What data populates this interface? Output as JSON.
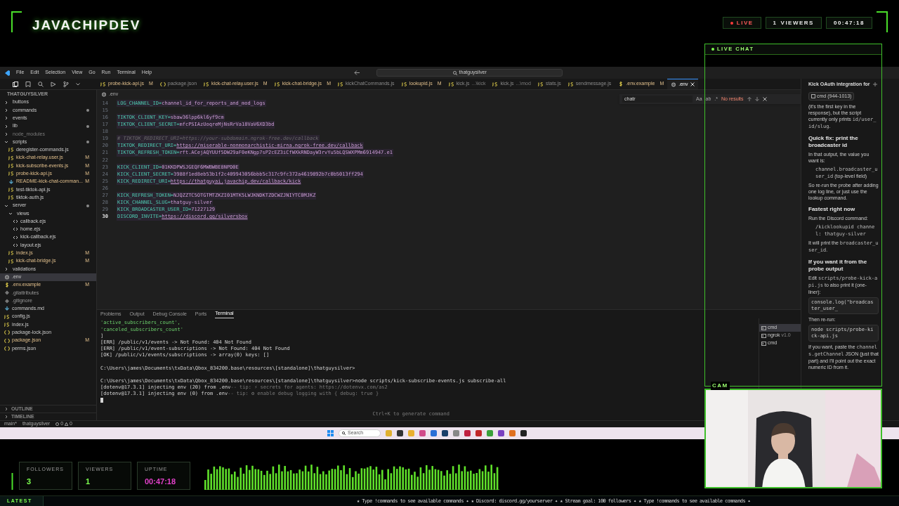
{
  "header": {
    "brand": "JAVACHIPDEV",
    "badges": [
      {
        "kind": "live",
        "text": "LIVE"
      },
      {
        "kind": "viewers",
        "count": "1",
        "text": "VIEWERS"
      },
      {
        "kind": "timer",
        "text": "00:47:18"
      }
    ]
  },
  "vscode": {
    "menu": [
      "File",
      "Edit",
      "Selection",
      "View",
      "Go",
      "Run",
      "Terminal",
      "Help"
    ],
    "search": "thatguysilver",
    "tabs": [
      {
        "label": "probe-kick-api.js",
        "kind": "js",
        "badge": "M",
        "selected": false
      },
      {
        "label": "package.json",
        "kind": "json",
        "selected": false
      },
      {
        "label": "kick-chat-relay.user.js",
        "kind": "js",
        "badge": "M",
        "selected": false
      },
      {
        "label": "kick-chat-bridge.js",
        "kind": "js",
        "badge": "M",
        "selected": false
      },
      {
        "label": "kickChatCommands.js",
        "kind": "js",
        "selected": false
      },
      {
        "label": "lookupid.js",
        "kind": "js",
        "badge": "M",
        "selected": false
      },
      {
        "label": "kick.js",
        "hint": "...\\kick",
        "kind": "js",
        "selected": false
      },
      {
        "label": "kick.js",
        "hint": "...\\mod",
        "kind": "js",
        "selected": false
      },
      {
        "label": "stats.js",
        "kind": "js",
        "selected": false
      },
      {
        "label": "sendmessage.js",
        "kind": "js",
        "selected": false
      },
      {
        "label": ".env.example",
        "kind": "dollar",
        "badge": "M",
        "selected": false
      },
      {
        "label": ".env",
        "kind": "gear",
        "selected": true
      }
    ],
    "explorer": {
      "title": "THATGUYSILVER",
      "items": [
        {
          "label": "buttons",
          "kind": "folder",
          "expanded": false,
          "dot": false,
          "dimmed": false,
          "selected": false
        },
        {
          "label": "commands",
          "kind": "folder",
          "expanded": false,
          "dot": true,
          "dimmed": false,
          "selected": false
        },
        {
          "label": "events",
          "kind": "folder",
          "expanded": false,
          "dot": false,
          "dimmed": false,
          "selected": false
        },
        {
          "label": "lib",
          "kind": "folder",
          "expanded": false,
          "dot": true,
          "dimmed": false,
          "selected": false
        },
        {
          "label": "node_modules",
          "kind": "folder",
          "expanded": false,
          "dot": false,
          "dimmed": true,
          "selected": false
        },
        {
          "label": "scripts",
          "kind": "folder",
          "expanded": true,
          "dot": true,
          "dimmed": false,
          "selected": false,
          "children": [
            {
              "label": "deregister-commands.js",
              "kind": "js",
              "selected": false
            },
            {
              "label": "kick-chat-relay.user.js",
              "kind": "js",
              "badge": "M",
              "selected": false
            },
            {
              "label": "kick-subscribe-events.js",
              "kind": "js",
              "badge": "M",
              "selected": false
            },
            {
              "label": "probe-kick-api.js",
              "kind": "js",
              "badge": "M",
              "selected": false
            },
            {
              "label": "README-kick-chat-comman...",
              "kind": "md",
              "badge": "M",
              "selected": false
            },
            {
              "label": "test-tiktok-api.js",
              "kind": "js",
              "selected": false
            },
            {
              "label": "tiktok-auth.js",
              "kind": "js",
              "selected": false
            }
          ]
        },
        {
          "label": "server",
          "kind": "folder",
          "expanded": true,
          "dot": true,
          "dimmed": false,
          "selected": false,
          "children": [
            {
              "label": "views",
              "kind": "folder",
              "expanded": true,
              "dot": false,
              "dimmed": false,
              "selected": false,
              "children": [
                {
                  "label": "callback.ejs",
                  "kind": "ejs",
                  "selected": false
                },
                {
                  "label": "home.ejs",
                  "kind": "ejs",
                  "selected": false
                },
                {
                  "label": "kick-callback.ejs",
                  "kind": "ejs",
                  "selected": false
                },
                {
                  "label": "layout.ejs",
                  "kind": "ejs",
                  "selected": false
                }
              ]
            },
            {
              "label": "index.js",
              "kind": "js",
              "badge": "M",
              "selected": false
            },
            {
              "label": "kick-chat-bridge.js",
              "kind": "js",
              "badge": "M",
              "selected": false
            }
          ]
        },
        {
          "label": "validations",
          "kind": "folder",
          "expanded": false,
          "dot": false,
          "dimmed": false,
          "selected": false
        },
        {
          "label": ".env",
          "kind": "gear",
          "selected": true
        },
        {
          "label": ".env.example",
          "kind": "dollar",
          "badge": "M",
          "selected": false
        },
        {
          "label": ".gitattributes",
          "kind": "git",
          "selected": false
        },
        {
          "label": ".gitignore",
          "kind": "git",
          "selected": false
        },
        {
          "label": "commands.md",
          "kind": "md",
          "selected": false
        },
        {
          "label": "config.js",
          "kind": "js",
          "selected": false
        },
        {
          "label": "index.js",
          "kind": "js",
          "selected": false
        },
        {
          "label": "package-lock.json",
          "kind": "json",
          "selected": false
        },
        {
          "label": "package.json",
          "kind": "json",
          "badge": "M",
          "selected": false
        },
        {
          "label": "perms.json",
          "kind": "json",
          "selected": false
        }
      ],
      "sections": [
        "OUTLINE",
        "TIMELINE"
      ]
    },
    "breadcrumb": ".env",
    "find": {
      "value": "chatr",
      "options": [
        "Aa",
        "ab",
        ".*"
      ],
      "result": "No results"
    },
    "code": [
      {
        "n": "14",
        "kind": "pair",
        "key": "LOG_CHANNEL_ID=",
        "value": "channel_id_for_reports_and_mod_logs",
        "link": false,
        "current": false
      },
      {
        "n": "15",
        "kind": "blank",
        "current": false
      },
      {
        "n": "16",
        "kind": "pair",
        "key": "TIKTOK_CLIENT_KEY=",
        "value": "sbaw36lpp6kl6yf9cm",
        "link": false,
        "current": false
      },
      {
        "n": "17",
        "kind": "pair",
        "key": "TIKTOK_CLIENT_SECRET=",
        "value": "mfcPSIAzUoqreMjNsRrVa18VaV6XD3bd",
        "link": false,
        "current": false
      },
      {
        "n": "18",
        "kind": "blank",
        "current": false
      },
      {
        "n": "19",
        "kind": "comment",
        "text": "# TIKTOK_REDIRECT_URI=https://your-subdomain.ngrok-free.dev/callback",
        "current": false
      },
      {
        "n": "20",
        "kind": "pair",
        "key": "TIKTOK_REDIRECT_URI=",
        "value": "https://miserable-nonmonarchistic-mirna.ngrok-free.dev/callback",
        "link": true,
        "current": false
      },
      {
        "n": "21",
        "kind": "pair",
        "key": "TIKTOK_REFRESH_TOKEN=",
        "value": "rft.ACejAQYUUf5DW29aF0eKNgp7sP2cEZ3iCfWXkRNDayW3rvYu5bLQSWXPMm6914947.e1",
        "link": false,
        "current": false
      },
      {
        "n": "22",
        "kind": "blank",
        "current": false
      },
      {
        "n": "23",
        "kind": "pair",
        "key": "KICK_CLIENT_ID=",
        "value": "01KKDPWSJGEQF6MWBWBE8NPD0E",
        "link": false,
        "current": false
      },
      {
        "n": "24",
        "kind": "pair",
        "key": "KICK_CLIENT_SECRET=",
        "value": "3988f1ed8eb53b1f2c409943056bbb5c317c9fc372a4619892b7c0b5013ff294",
        "link": false,
        "current": false
      },
      {
        "n": "25",
        "kind": "pair",
        "key": "KICK_REDIRECT_URI=",
        "value": "https://thatguyai.javachip.dev/callback/kick",
        "link": true,
        "current": false
      },
      {
        "n": "26",
        "kind": "blank",
        "current": false
      },
      {
        "n": "27",
        "kind": "pair",
        "key": "KICK_REFRESH_TOKEN=",
        "value": "NJQZZTC5OTGTMTZKZI01MTK5LWJKNDKTZDCWZJNIYTC0MJKZ",
        "link": false,
        "current": false
      },
      {
        "n": "28",
        "kind": "pair",
        "key": "KICK_CHANNEL_SLUG=",
        "value": "thatguy-silver",
        "link": false,
        "current": false
      },
      {
        "n": "29",
        "kind": "pair",
        "key": "KICK_BROADCASTER_USER_ID=",
        "value": "71227129",
        "link": false,
        "current": false
      },
      {
        "n": "30",
        "kind": "pair",
        "key": "DISCORD_INVITE=",
        "value": "https://discord.gg/silversbox",
        "link": true,
        "current": true
      }
    ],
    "panel_tabs": [
      {
        "label": "Problems",
        "selected": false
      },
      {
        "label": "Output",
        "selected": false
      },
      {
        "label": "Debug Console",
        "selected": false
      },
      {
        "label": "Ports",
        "selected": false
      },
      {
        "label": "Terminal",
        "selected": true
      }
    ],
    "terminal": [
      {
        "kind": "string",
        "text": "  'active_subscribers_count',"
      },
      {
        "kind": "string",
        "text": "  'canceled_subscribers_count'"
      },
      {
        "kind": "plain",
        "text": "]"
      },
      {
        "kind": "plain",
        "text": "[ERR] /public/v1/events -> Not Found: 404 Not Found"
      },
      {
        "kind": "plain",
        "text": "[ERR] /public/v1/event-subscriptions -> Not Found: 404 Not Found"
      },
      {
        "kind": "plain",
        "text": "[OK] /public/v1/events/subscriptions -> array(0) keys: []"
      },
      {
        "kind": "blank"
      },
      {
        "kind": "plain",
        "text": "C:\\Users\\james\\Documents\\txData\\Qbox_834200.base\\resources\\[standalone]\\thatguysilver>"
      },
      {
        "kind": "blank"
      },
      {
        "kind": "plain",
        "text": "C:\\Users\\james\\Documents\\txData\\Qbox_834200.base\\resources\\[standalone]\\thatguysilver>node scripts/kick-subscribe-events.js subscribe-all"
      },
      {
        "kind": "tip",
        "text": "[dotenv@17.3.1] injecting env (20) from .env",
        "tip": " -- tip: ⚡ secrets for agents: https://dotenvx.com/as2"
      },
      {
        "kind": "tip",
        "text": "[dotenv@17.3.1] injecting env (0) from .env",
        "tip": " -- tip: ⚙ enable debug logging with { debug: true }"
      },
      {
        "kind": "cursor"
      }
    ],
    "terminal_hint": "Ctrl+K to generate command",
    "terminals": [
      {
        "label": "cmd",
        "selected": true
      },
      {
        "label": "ngrok",
        "hint": "v1.0",
        "selected": false
      },
      {
        "label": "cmd",
        "selected": false
      }
    ],
    "status": {
      "branch": "main*",
      "folder": "thatguysilver",
      "errors": "0",
      "warnings": "0"
    },
    "chat": {
      "title": "Kick OAuth integration for",
      "context": "cmd (944-1013)",
      "blocks": [
        {
          "kind": "p",
          "parts": [
            {
              "t": "(it's the first key in the response), but the script currently only prints "
            },
            {
              "t": "id/user_id/slug",
              "code": true
            },
            {
              "t": "."
            }
          ]
        },
        {
          "kind": "h",
          "parts": [
            {
              "t": "Quick fix: print the broadcaster id"
            }
          ]
        },
        {
          "kind": "p",
          "parts": [
            {
              "t": "In that output, the value you want is:"
            }
          ]
        },
        {
          "kind": "li",
          "parts": [
            {
              "t": "channel.broadcaster_user_id",
              "code": true
            },
            {
              "t": " (top-level field)"
            }
          ]
        },
        {
          "kind": "p",
          "parts": [
            {
              "t": "So re-run the probe after adding one log line, or just use the lookup command."
            }
          ]
        },
        {
          "kind": "h",
          "parts": [
            {
              "t": "Fastest right now"
            }
          ]
        },
        {
          "kind": "p",
          "parts": [
            {
              "t": "Run the Discord command:"
            }
          ]
        },
        {
          "kind": "li",
          "parts": [
            {
              "t": "/kicklookupid channel: thatguy-silver",
              "code": true
            }
          ]
        },
        {
          "kind": "p",
          "parts": [
            {
              "t": "It will print the "
            },
            {
              "t": "broadcaster_user_id",
              "code": true
            },
            {
              "t": "."
            }
          ]
        },
        {
          "kind": "h",
          "parts": [
            {
              "t": "If you want it from the probe output"
            }
          ]
        },
        {
          "kind": "p",
          "parts": [
            {
              "t": "Edit "
            },
            {
              "t": "scripts/probe-kick-api.js",
              "code": true
            },
            {
              "t": " to also print it (one-liner):"
            }
          ]
        },
        {
          "kind": "pre",
          "parts": [
            {
              "t": "console.log(\"broadcaster_user_"
            }
          ]
        },
        {
          "kind": "p",
          "parts": [
            {
              "t": "Then re-run:"
            }
          ]
        },
        {
          "kind": "pre",
          "parts": [
            {
              "t": "node scripts/probe-kick-api.js"
            }
          ]
        },
        {
          "kind": "p",
          "parts": [
            {
              "t": "If you want, paste the "
            },
            {
              "t": "channels.getChannel",
              "code": true
            },
            {
              "t": " JSON (just that part) and I'll point out the exact numeric ID from it."
            }
          ]
        }
      ]
    },
    "taskbar": {
      "search": "Search"
    }
  },
  "live_chat": {
    "title": "LIVE CHAT"
  },
  "cam": {
    "label": "CAM"
  },
  "stats": [
    {
      "label": "FOLLOWERS",
      "value": "3",
      "color": "#7cff4f"
    },
    {
      "label": "VIEWERS",
      "value": "1",
      "color": "#7cff4f"
    },
    {
      "label": "UPTIME",
      "value": "00:47:18",
      "color": "#e040c8"
    }
  ],
  "ticker": {
    "label": "LATEST",
    "text": "★ Type !commands to see available commands ✦ ★ Discord: discord.gg/yourserver ✦ ★ Stream goal: 100 followers ✦ ★ Type !commands to see available commands ✦"
  }
}
